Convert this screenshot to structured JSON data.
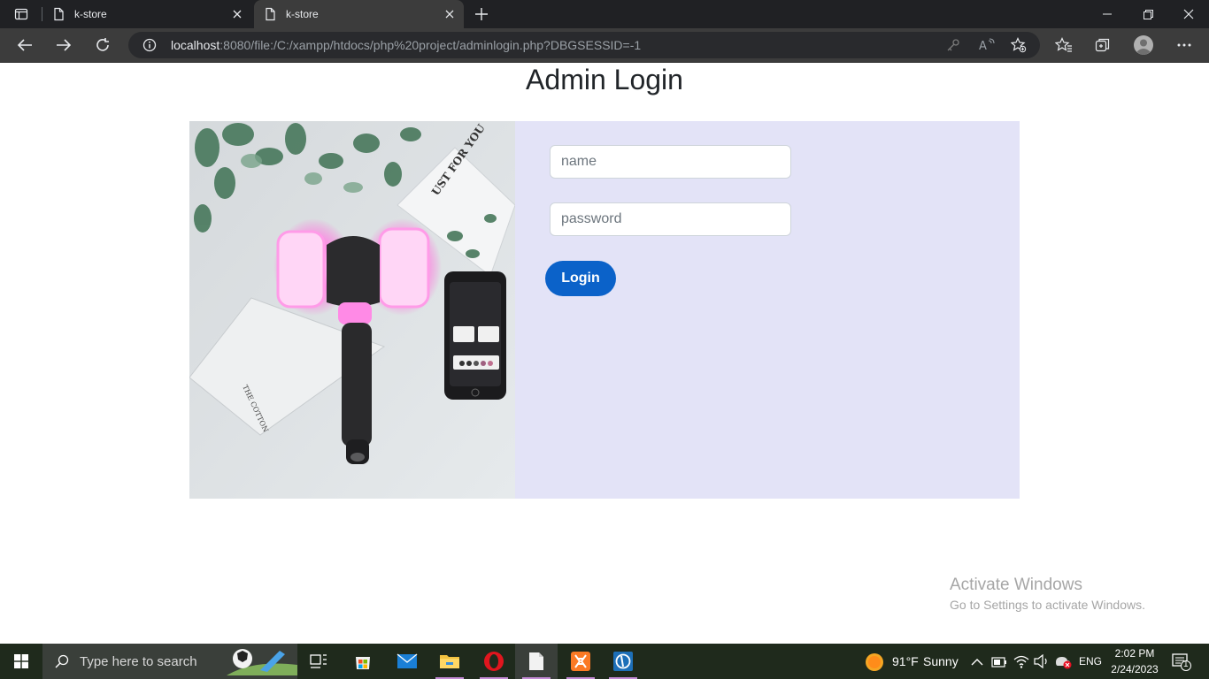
{
  "browser": {
    "tabs": [
      {
        "title": "k-store",
        "active": false
      },
      {
        "title": "k-store",
        "active": true
      }
    ],
    "url_host": "localhost",
    "url_rest": ":8080/file:/C:/xampp/htdocs/php%20project/adminlogin.php?DBGSESSID=-1"
  },
  "page": {
    "title": "Admin Login",
    "form": {
      "name_placeholder": "name",
      "password_placeholder": "password",
      "login_label": "Login"
    }
  },
  "watermark": {
    "line1": "Activate Windows",
    "line2": "Go to Settings to activate Windows."
  },
  "taskbar": {
    "search_placeholder": "Type here to search",
    "weather_temp": "91°F",
    "weather_desc": "Sunny",
    "language": "ENG",
    "time": "2:02 PM",
    "date": "2/24/2023",
    "notification_count": "1"
  },
  "colors": {
    "accent": "#0b62c9",
    "card_bg": "#e3e3f7",
    "browser_dark": "#202124"
  }
}
